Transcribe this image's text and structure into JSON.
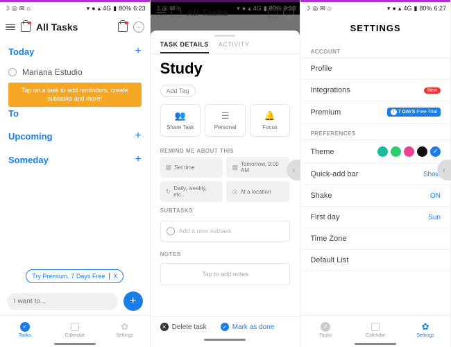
{
  "status": {
    "signal": "4G",
    "battery": "80%",
    "t1": "6:23",
    "t2": "6:28",
    "t3": "6:27"
  },
  "p1": {
    "title": "All Tasks",
    "sections": {
      "today": "Today",
      "tomorrow": "To",
      "upcoming": "Upcoming",
      "someday": "Someday"
    },
    "task": "Mariana Estudio",
    "tooltip": "Tap on a task to add reminders, create subtasks and more!",
    "promo": "Try Premium. 7 Days Free",
    "promo_x": "X",
    "input_ph": "I want to...",
    "tabs": {
      "tasks": "Tasks",
      "calendar": "Calendar",
      "settings": "Settings"
    }
  },
  "p2": {
    "back_title": "All Tasks",
    "tabs": {
      "details": "TASK DETAILS",
      "activity": "ACTIVITY"
    },
    "title": "Study",
    "add_tag": "Add Tag",
    "actions": {
      "share": "Share Task",
      "personal": "Personal",
      "focus": "Focus"
    },
    "remind": "REMIND ME ABOUT THIS",
    "opts": {
      "time": "Set time",
      "date": "Tomorrow, 9:00 AM",
      "repeat": "Daily, weekly, etc..",
      "loc": "At a location"
    },
    "subtasks": "SUBTASKS",
    "sub_ph": "Add a new subtask",
    "notes": "NOTES",
    "notes_ph": "Tap to add notes",
    "delete": "Delete task",
    "done": "Mark as done"
  },
  "p3": {
    "title": "SETTINGS",
    "account": "ACCOUNT",
    "profile": "Profile",
    "integrations": "Integrations",
    "new": "New",
    "premium": "Premium",
    "premium_badge": "7 DAYS",
    "premium_badge2": "Free Trial",
    "prefs": "PREFERENCES",
    "theme": "Theme",
    "colors": [
      "#1abc9c",
      "#2ecc71",
      "#e84393",
      "#111",
      "#1a7de8"
    ],
    "quickadd": "Quick-add bar",
    "quickadd_v": "Show",
    "shake": "Shake",
    "shake_v": "ON",
    "firstday": "First day",
    "firstday_v": "Sun",
    "tz": "Time Zone",
    "deflist": "Default List",
    "tabs": {
      "tasks": "Tasks",
      "calendar": "Calendar",
      "settings": "Settings"
    }
  }
}
